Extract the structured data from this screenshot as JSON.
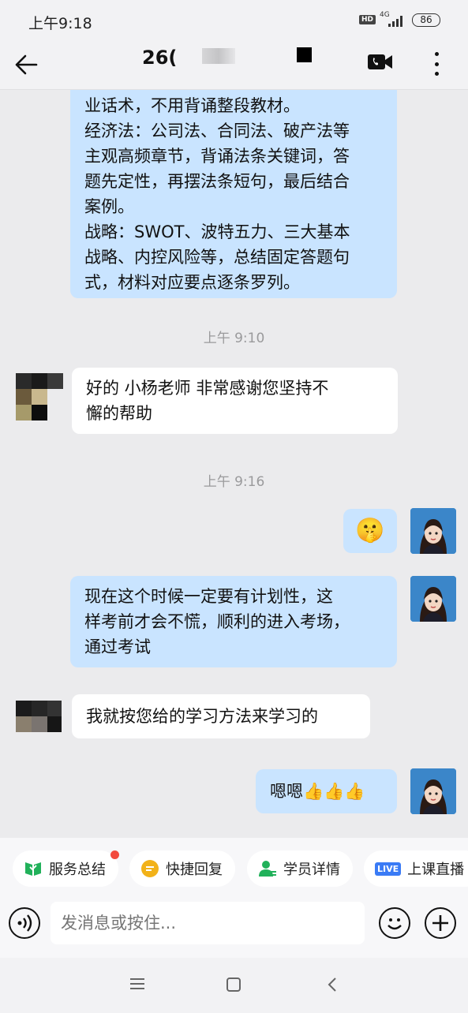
{
  "status_bar": {
    "time": "上午9:18",
    "hd": "HD",
    "network": "4G",
    "battery": "86"
  },
  "header": {
    "title": "26("
  },
  "messages": {
    "m1": [
      "业话术，不用背诵整段教材。",
      "经济法：公司法、合同法、破产法等",
      "主观高频章节，背诵法条关键词，答",
      "题先定性，再摆法条短句，最后结合",
      "案例。",
      "战略：SWOT、波特五力、三大基本",
      "战略、内控风险等，总结固定答题句",
      "式，材料对应要点逐条罗列。"
    ],
    "ts1": "上午 9:10",
    "m2": [
      "好的  小杨老师  非常感谢您坚持不",
      "懈的帮助"
    ],
    "ts2": "上午 9:16",
    "m3_emoji": "🤫",
    "m4": [
      "现在这个时候一定要有计划性，这",
      "样考前才会不慌，顺利的进入考场，",
      "通过考试"
    ],
    "m5": "我就按您给的学习方法来学习的",
    "m6_text": "嗯嗯",
    "m6_emoji": "👍👍👍"
  },
  "quick_actions": [
    {
      "label": "服务总结"
    },
    {
      "label": "快捷回复"
    },
    {
      "label": "学员详情"
    },
    {
      "label": "上课直播",
      "badge": "LIVE"
    }
  ],
  "input": {
    "placeholder": "发消息或按住..."
  },
  "colors": {
    "outgoing_bubble": "#c9e4ff",
    "incoming_bubble": "#ffffff",
    "background": "#ebebed"
  }
}
